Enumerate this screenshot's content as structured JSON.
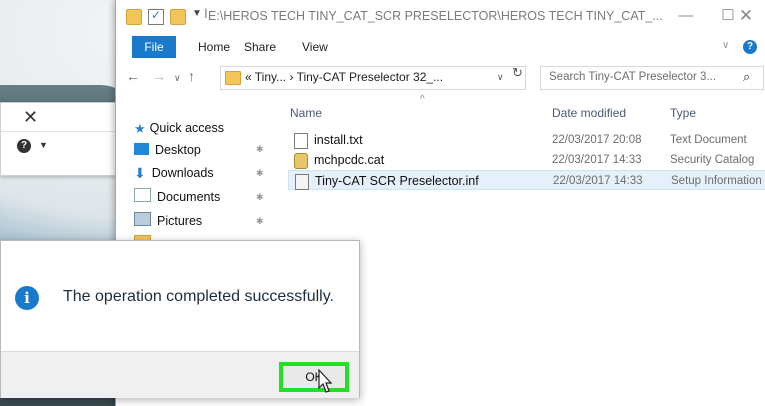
{
  "window": {
    "title": "E:\\HEROS TECH TINY_CAT_SCR PRESELECTOR\\HEROS TECH TINY_CAT_...",
    "controls": {
      "minimize": "—",
      "maximize": "☐",
      "close": "✕"
    }
  },
  "ribbon": {
    "tabs": [
      "File",
      "Home",
      "Share",
      "View"
    ]
  },
  "address": {
    "path": "« Tiny... › Tiny-CAT Preselector 32_...",
    "search_placeholder": "Search Tiny-CAT Preselector 3..."
  },
  "nav_pane": {
    "items": [
      {
        "label": "Quick access",
        "icon": "star-icon",
        "pinned": false
      },
      {
        "label": "Desktop",
        "icon": "desktop-icon",
        "pinned": true
      },
      {
        "label": "Downloads",
        "icon": "download-icon",
        "pinned": true
      },
      {
        "label": "Documents",
        "icon": "documents-icon",
        "pinned": true
      },
      {
        "label": "Pictures",
        "icon": "pictures-icon",
        "pinned": true
      }
    ]
  },
  "file_list": {
    "columns": {
      "name": "Name",
      "date": "Date modified",
      "type": "Type"
    },
    "rows": [
      {
        "name": "install.txt",
        "date": "22/03/2017 20:08",
        "type": "Text Document",
        "icon": "text-file-icon",
        "selected": false
      },
      {
        "name": "mchpcdc.cat",
        "date": "22/03/2017 14:33",
        "type": "Security Catalog",
        "icon": "catalog-file-icon",
        "selected": false
      },
      {
        "name": "Tiny-CAT SCR Preselector.inf",
        "date": "22/03/2017 14:33",
        "type": "Setup Information",
        "icon": "setup-file-icon",
        "selected": true
      }
    ]
  },
  "dialog": {
    "message": "The operation completed successfully.",
    "ok_label": "OK",
    "info_glyph": "i"
  },
  "colors": {
    "accent": "#1979ca",
    "highlight": "#22e022",
    "selection": "#e5f0fb"
  }
}
